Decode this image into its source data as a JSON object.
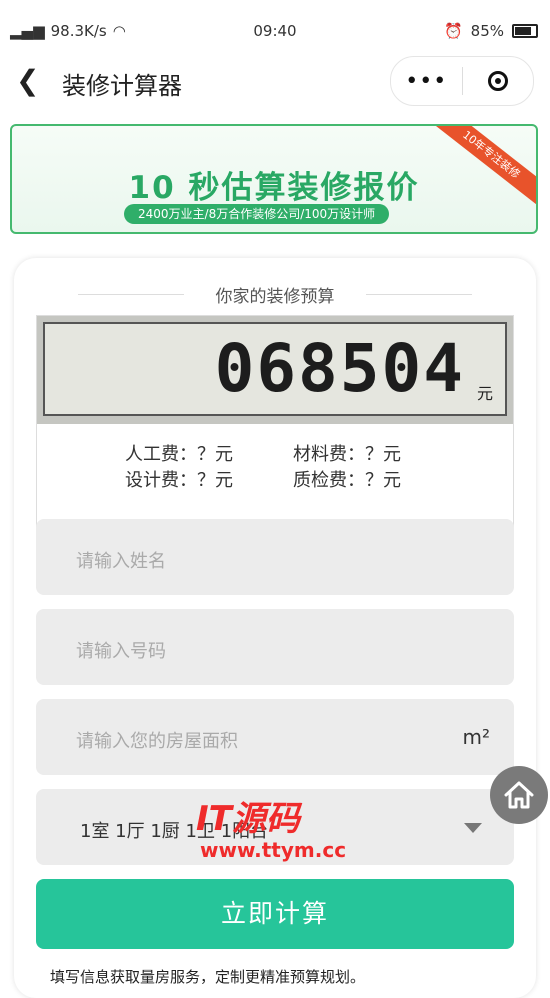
{
  "status_bar": {
    "network": "98.3K/s",
    "time": "09:40",
    "battery": "85%"
  },
  "nav": {
    "title": "装修计算器",
    "menu_label": "•••"
  },
  "banner": {
    "title": "10 秒估算装修报价",
    "subtitle": "2400万业主/8万合作装修公司/100万设计师",
    "ribbon": "10年专注装修"
  },
  "card": {
    "title": "你家的装修预算",
    "budget_value": "068504",
    "budget_unit": "元",
    "fees": {
      "labor": "人工费：？元",
      "material": "材料费：？元",
      "design": "设计费：？元",
      "inspection": "质检费：？元"
    },
    "name_placeholder": "请输入姓名",
    "phone_placeholder": "请输入号码",
    "area_placeholder": "请输入您的房屋面积",
    "area_unit": "m²",
    "layout_value": "1室 1厅 1厨 1卫 1阳台",
    "calc_button": "立即计算",
    "tip": "填写信息获取量房服务，定制更精准预算规划。"
  },
  "watermark": {
    "line1": "IT源码",
    "line2": "www.ttym.cc"
  }
}
